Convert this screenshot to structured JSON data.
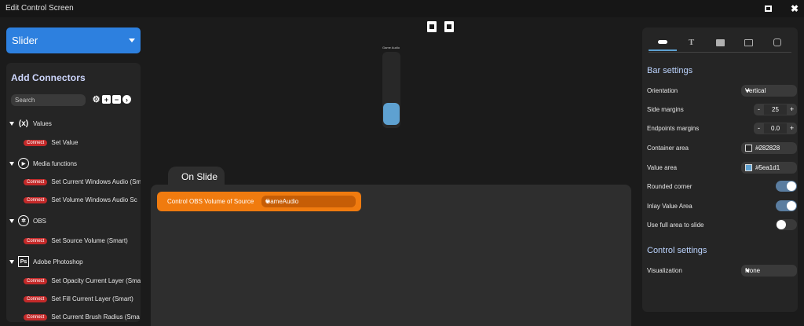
{
  "window": {
    "title": "Edit Control Screen"
  },
  "control_type": {
    "selected": "Slider"
  },
  "connectors": {
    "heading": "Add Connectors",
    "search_placeholder": "Search",
    "connect_badge": "Connect",
    "categories": [
      {
        "label": "Values",
        "icon": "variable-icon",
        "items": [
          "Set Value"
        ]
      },
      {
        "label": "Media functions",
        "icon": "play-icon",
        "items": [
          "Set Current Windows Audio (Sm",
          "Set Volume Windows Audio Sc"
        ]
      },
      {
        "label": "OBS",
        "icon": "obs-icon",
        "items": [
          "Set Source Volume (Smart)"
        ]
      },
      {
        "label": "Adobe Photoshop",
        "icon": "photoshop-icon",
        "items": [
          "Set Opacity Current Layer (Sma",
          "Set Fill Current Layer (Smart)",
          "Set Current Brush Radius (Sma"
        ]
      }
    ]
  },
  "preview": {
    "label": "Game Audio",
    "value_fraction": 0.3
  },
  "on_slide": {
    "tab_label": "On Slide",
    "action_label": "Control OBS Volume of Source",
    "source_value": "GameAudio"
  },
  "settings": {
    "bar_heading": "Bar settings",
    "orientation": {
      "label": "Orientation",
      "value": "Vertical"
    },
    "side_margins": {
      "label": "Side margins",
      "value": "25"
    },
    "endpoints_margins": {
      "label": "Endpoints margins",
      "value": "0.0"
    },
    "container_area": {
      "label": "Container area",
      "value": "#282828"
    },
    "value_area": {
      "label": "Value area",
      "value": "#5ea1d1"
    },
    "rounded_corner": {
      "label": "Rounded corner",
      "on": true
    },
    "inlay_value_area": {
      "label": "Inlay Value Area",
      "on": true
    },
    "use_full_area": {
      "label": "Use full area to slide",
      "on": false
    },
    "control_heading": "Control settings",
    "visualization": {
      "label": "Visualization",
      "value": "None"
    },
    "stepper_minus": "-",
    "stepper_plus": "+"
  },
  "colors": {
    "accent_blue": "#2d80df",
    "action_orange": "#f07b0f",
    "connect_red": "#c42a2a",
    "value_blue": "#5ea1d1",
    "container": "#282828"
  }
}
